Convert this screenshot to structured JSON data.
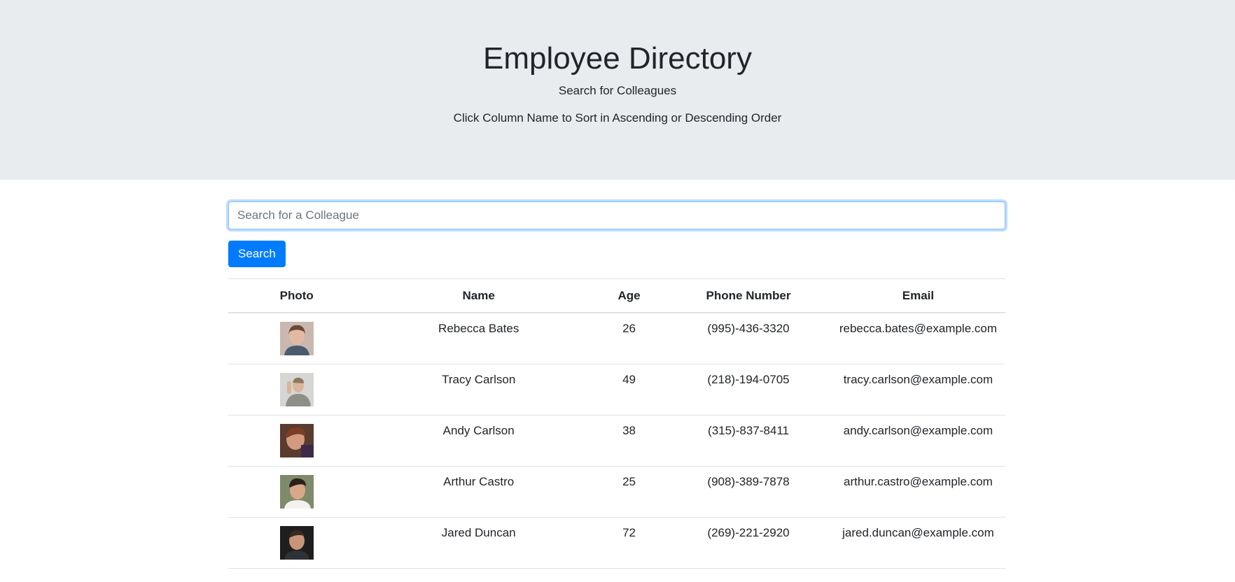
{
  "header": {
    "title": "Employee Directory",
    "subtitle": "Search for Colleagues",
    "hint": "Click Column Name to Sort in Ascending or Descending Order"
  },
  "search": {
    "placeholder": "Search for a Colleague",
    "value": "",
    "button_label": "Search"
  },
  "table": {
    "columns": [
      "Photo",
      "Name",
      "Age",
      "Phone Number",
      "Email"
    ],
    "rows": [
      {
        "photo": "avatar-rebecca-bates",
        "name": "Rebecca Bates",
        "age": "26",
        "phone": "(995)-436-3320",
        "email": "rebecca.bates@example.com"
      },
      {
        "photo": "avatar-tracy-carlson",
        "name": "Tracy Carlson",
        "age": "49",
        "phone": "(218)-194-0705",
        "email": "tracy.carlson@example.com"
      },
      {
        "photo": "avatar-andy-carlson",
        "name": "Andy Carlson",
        "age": "38",
        "phone": "(315)-837-8411",
        "email": "andy.carlson@example.com"
      },
      {
        "photo": "avatar-arthur-castro",
        "name": "Arthur Castro",
        "age": "25",
        "phone": "(908)-389-7878",
        "email": "arthur.castro@example.com"
      },
      {
        "photo": "avatar-jared-duncan",
        "name": "Jared Duncan",
        "age": "72",
        "phone": "(269)-221-2920",
        "email": "jared.duncan@example.com"
      }
    ]
  },
  "colors": {
    "jumbotron_bg": "#e9ecef",
    "primary": "#007bff",
    "border": "#dee2e6",
    "text": "#212529"
  }
}
